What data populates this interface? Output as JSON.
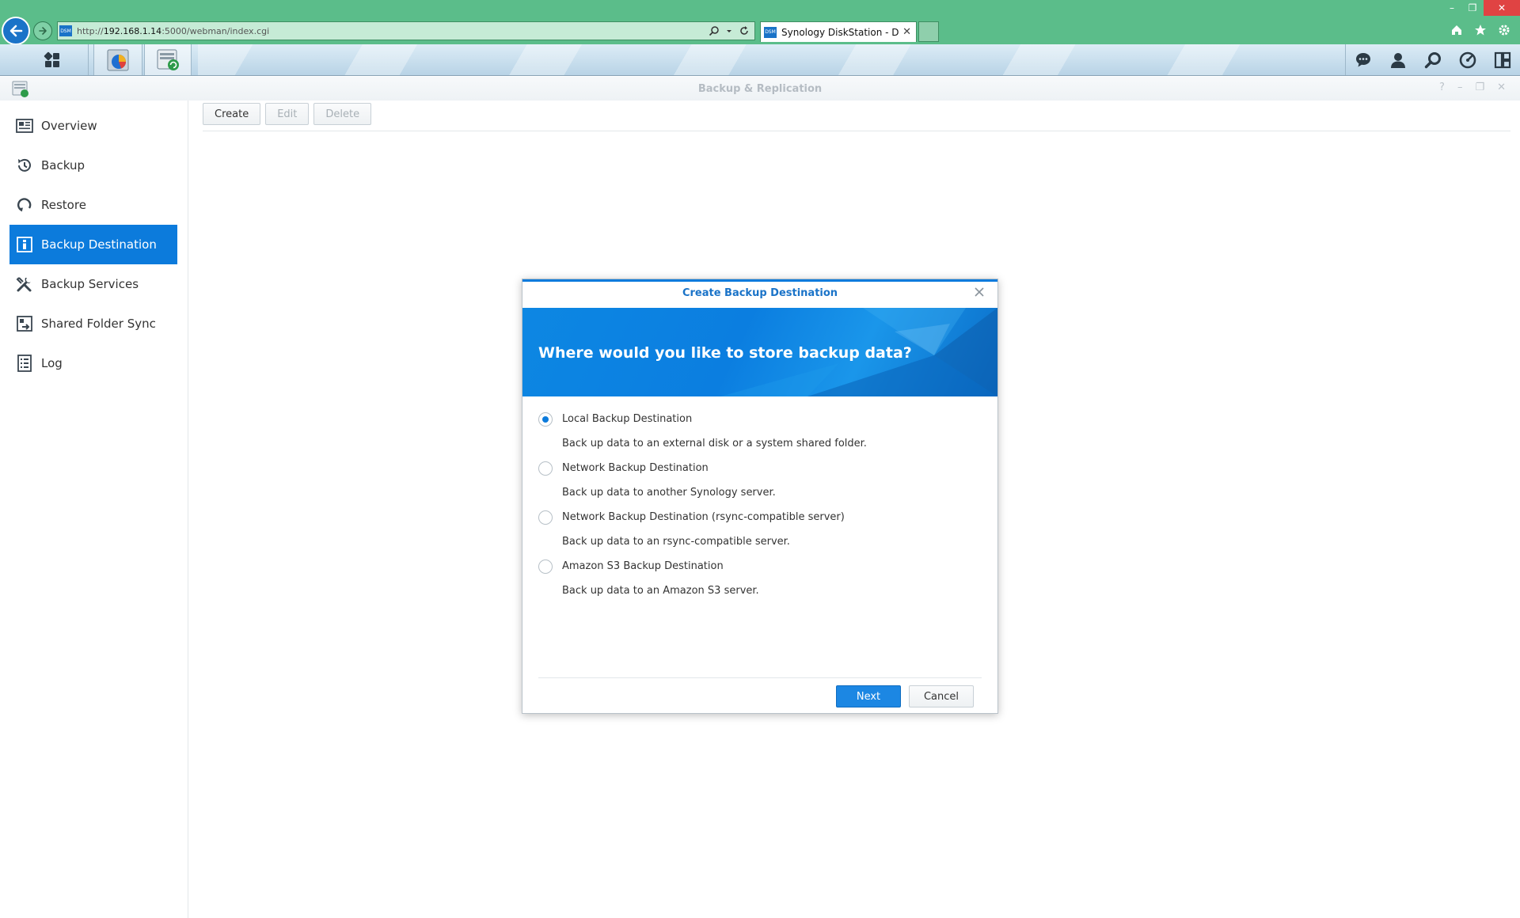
{
  "browser": {
    "url_prefix": "http://",
    "url_host": "192.168.1.14",
    "url_rest": ":5000/webman/index.cgi",
    "tab_title": "Synology DiskStation - Disk...",
    "favicon_text": "DSM",
    "window_controls": {
      "minimize": "–",
      "maximize": "❐",
      "close": "✕"
    }
  },
  "app": {
    "title": "Backup & Replication"
  },
  "sidebar": {
    "items": [
      {
        "label": "Overview",
        "icon": "overview-icon"
      },
      {
        "label": "Backup",
        "icon": "backup-icon"
      },
      {
        "label": "Restore",
        "icon": "restore-icon"
      },
      {
        "label": "Backup Destination",
        "icon": "backup-destination-icon",
        "active": true
      },
      {
        "label": "Backup Services",
        "icon": "backup-services-icon"
      },
      {
        "label": "Shared Folder Sync",
        "icon": "shared-folder-sync-icon"
      },
      {
        "label": "Log",
        "icon": "log-icon"
      }
    ]
  },
  "toolbar": {
    "create_label": "Create",
    "edit_label": "Edit",
    "delete_label": "Delete"
  },
  "dialog": {
    "title": "Create Backup Destination",
    "heading": "Where would you like to store backup data?",
    "options": [
      {
        "label": "Local Backup Destination",
        "description": "Back up data to an external disk or a system shared folder.",
        "selected": true
      },
      {
        "label": "Network Backup Destination",
        "description": "Back up data to another Synology server.",
        "selected": false
      },
      {
        "label": "Network Backup Destination (rsync-compatible server)",
        "description": "Back up data to an rsync-compatible server.",
        "selected": false
      },
      {
        "label": "Amazon S3 Backup Destination",
        "description": "Back up data to an Amazon S3 server.",
        "selected": false
      }
    ],
    "next_label": "Next",
    "cancel_label": "Cancel"
  },
  "colors": {
    "browser_chrome": "#5bbd8a",
    "accent": "#0c7bdc",
    "dialog_title": "#1a73c8"
  }
}
